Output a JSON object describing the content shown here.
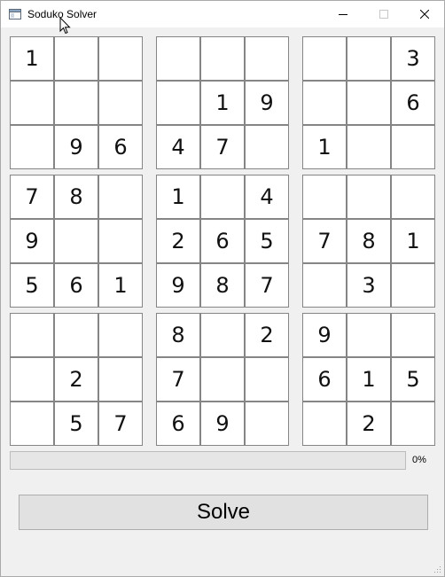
{
  "window": {
    "title": "Soduko Solver",
    "app_icon": "window-icon",
    "controls": [
      "minimize-icon",
      "maximize-icon",
      "close-icon"
    ]
  },
  "board": [
    [
      "1",
      "",
      "",
      "",
      "",
      "",
      "",
      "",
      "3"
    ],
    [
      "",
      "",
      "",
      "",
      "1",
      "9",
      "",
      "",
      "6"
    ],
    [
      "",
      "9",
      "6",
      "4",
      "7",
      "",
      "1",
      "",
      ""
    ],
    [
      "7",
      "8",
      "",
      "1",
      "",
      "4",
      "",
      "",
      ""
    ],
    [
      "9",
      "",
      "",
      "2",
      "6",
      "5",
      "7",
      "8",
      "1"
    ],
    [
      "5",
      "6",
      "1",
      "9",
      "8",
      "7",
      "",
      "3",
      ""
    ],
    [
      "",
      "",
      "",
      "8",
      "",
      "2",
      "9",
      "",
      ""
    ],
    [
      "",
      "2",
      "",
      "7",
      "",
      "",
      "6",
      "1",
      "5"
    ],
    [
      "",
      "5",
      "7",
      "6",
      "9",
      "",
      "",
      "2",
      ""
    ]
  ],
  "progress": {
    "value": 0,
    "label": "0%",
    "color": "#06b025"
  },
  "solve_button": {
    "label": "Solve"
  }
}
